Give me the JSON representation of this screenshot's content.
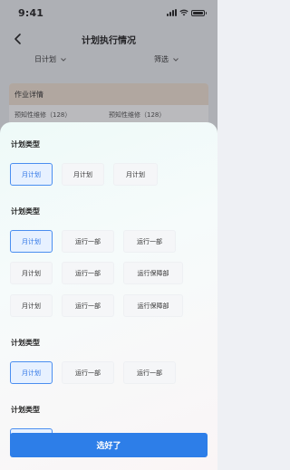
{
  "status_bar": {
    "time": "9:41"
  },
  "nav": {
    "title": "计划执行情况"
  },
  "filters": {
    "plan_type": "日计划",
    "screen": "筛选"
  },
  "card": {
    "header": "作业详情",
    "items": [
      "预知性维修（128）",
      "预知性维修（128）"
    ]
  },
  "sheet": {
    "sections": [
      {
        "title": "计划类型",
        "options": [
          {
            "label": "月计划",
            "selected": true
          },
          {
            "label": "月计划",
            "selected": false
          },
          {
            "label": "月计划",
            "selected": false
          }
        ]
      },
      {
        "title": "计划类型",
        "options": [
          {
            "label": "月计划",
            "selected": true
          },
          {
            "label": "运行一部",
            "selected": false
          },
          {
            "label": "运行一部",
            "selected": false
          },
          {
            "label": "月计划",
            "selected": false
          },
          {
            "label": "运行一部",
            "selected": false
          },
          {
            "label": "运行保障部",
            "selected": false
          },
          {
            "label": "月计划",
            "selected": false
          },
          {
            "label": "运行一部",
            "selected": false
          },
          {
            "label": "运行保障部",
            "selected": false
          }
        ]
      },
      {
        "title": "计划类型",
        "options": [
          {
            "label": "月计划",
            "selected": true
          },
          {
            "label": "运行一部",
            "selected": false
          },
          {
            "label": "运行一部",
            "selected": false
          }
        ]
      },
      {
        "title": "计划类型",
        "options": []
      }
    ],
    "confirm_label": "选好了"
  },
  "colors": {
    "accent": "#2d7ee8",
    "selected_bg": "#e7f1ff",
    "card_header": "#f2e4d4"
  }
}
